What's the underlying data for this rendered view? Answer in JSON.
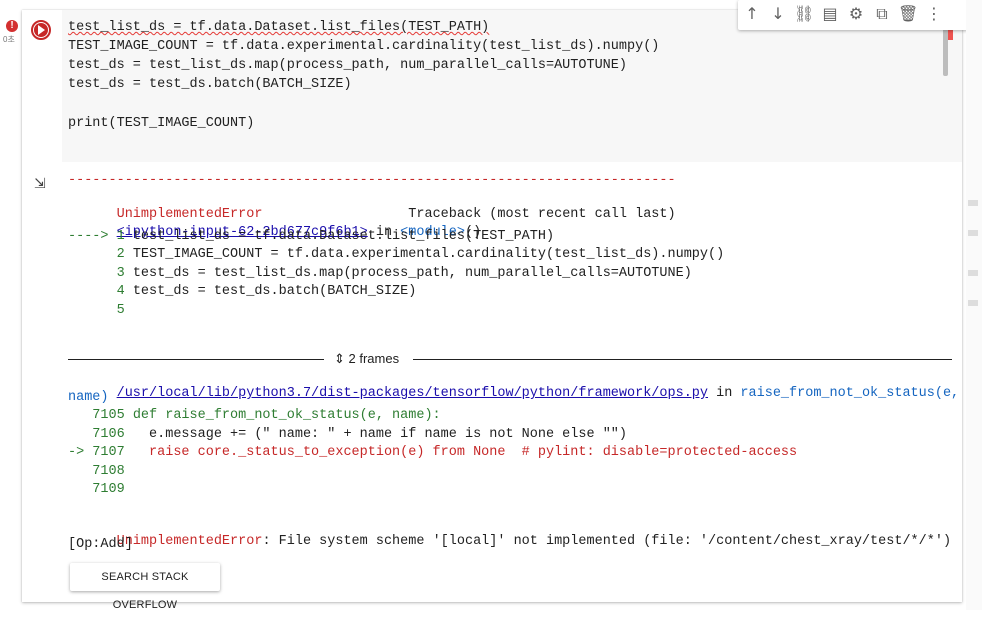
{
  "gutter": {
    "error_badge": "!",
    "exec_count": "0초"
  },
  "code": {
    "lines": [
      "test_list_ds = tf.data.Dataset.list_files(TEST_PATH)",
      "TEST_IMAGE_COUNT = tf.data.experimental.cardinality(test_list_ds).numpy()",
      "test_ds = test_list_ds.map(process_path, num_parallel_calls=AUTOTUNE)",
      "test_ds = test_ds.batch(BATCH_SIZE)",
      "",
      "print(TEST_IMAGE_COUNT)"
    ]
  },
  "toolbar": {
    "icons": [
      "arrow-up-icon",
      "arrow-down-icon",
      "link-icon",
      "comment-icon",
      "gear-icon",
      "mirror-icon",
      "trash-icon",
      "more-icon"
    ]
  },
  "output": {
    "dashes": "---------------------------------------------------------------------------",
    "error_name": "UnimplementedError",
    "traceback_label": "Traceback (most recent call last)",
    "frame1_link": "<ipython-input-62-2bd677c9f6b1>",
    "frame1_in": " in ",
    "frame1_module": "<module>",
    "frame1_parens": "()",
    "frame1_lines": [
      {
        "prefix": "----> 1 ",
        "code": "test_list_ds = tf.data.Dataset.list_files(TEST_PATH)"
      },
      {
        "prefix": "      2 ",
        "code": "TEST_IMAGE_COUNT = tf.data.experimental.cardinality(test_list_ds).numpy()"
      },
      {
        "prefix": "      3 ",
        "code": "test_ds = test_list_ds.map(process_path, num_parallel_calls=AUTOTUNE)"
      },
      {
        "prefix": "      4 ",
        "code": "test_ds = test_ds.batch(BATCH_SIZE)"
      },
      {
        "prefix": "      5",
        "code": ""
      }
    ],
    "frames_toggle": "2 frames",
    "frame2_link": "/usr/local/lib/python3.7/dist-packages/tensorflow/python/framework/ops.py",
    "frame2_in": " in ",
    "frame2_func": "raise_from_not_ok_status(e,",
    "frame2_func_cont": "name)",
    "frame2_lines": [
      {
        "prefix": "   7105 ",
        "code": "def raise_from_not_ok_status(e, name):"
      },
      {
        "prefix": "   7106 ",
        "code": "  e.message += (\" name: \" + name if name is not None else \"\")"
      },
      {
        "prefix": "-> 7107 ",
        "code": "  raise core._status_to_exception(e) from None  # pylint: disable=protected-access"
      },
      {
        "prefix": "   7108",
        "code": ""
      },
      {
        "prefix": "   7109",
        "code": ""
      }
    ],
    "final_error_name": "UnimplementedError",
    "final_error_msg": ": File system scheme '[local]' not implemented (file: '/content/chest_xray/test/*/*')",
    "final_error_msg2": "[Op:Add]"
  },
  "search_button": "SEARCH STACK OVERFLOW"
}
